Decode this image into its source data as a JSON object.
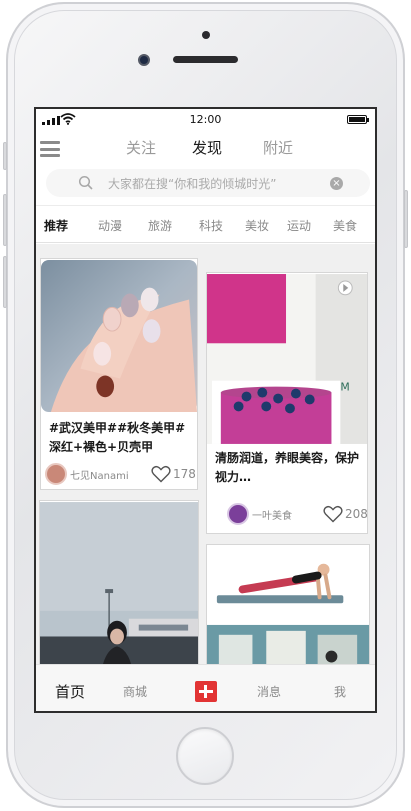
{
  "status": {
    "time": "12:00"
  },
  "top_tabs": [
    {
      "label": "关注"
    },
    {
      "label": "发现"
    },
    {
      "label": "附近"
    }
  ],
  "search": {
    "placeholder": "大家都在搜“你和我的倾城时光”"
  },
  "categories": [
    {
      "label": "推荐"
    },
    {
      "label": "动漫"
    },
    {
      "label": "旅游"
    },
    {
      "label": "科技"
    },
    {
      "label": "美妆"
    },
    {
      "label": "运动"
    },
    {
      "label": "美食"
    }
  ],
  "cards": [
    {
      "title": "#武汉美甲##秋冬美甲#深红+裸色+贝壳甲",
      "author": "七见Nanami",
      "likes": "178",
      "image": "nails-icon"
    },
    {
      "title": "清肠润道，养眼美容，保护视力…",
      "author": "一叶美食",
      "likes": "208",
      "image": "purple-smoothie-icon"
    },
    {
      "title": "",
      "author": "",
      "likes": "",
      "image": "city-seaside-portrait-icon"
    },
    {
      "title": "",
      "author": "",
      "likes": "",
      "image": "yoga-plank-icon"
    }
  ],
  "bottom_tabs": [
    {
      "label": "首页"
    },
    {
      "label": "商城"
    },
    {
      "label": "消息"
    },
    {
      "label": "我"
    }
  ],
  "colors": {
    "accent": "#e23434",
    "active_text": "#1a1a1a",
    "inactive_text": "#8a8a8a"
  }
}
